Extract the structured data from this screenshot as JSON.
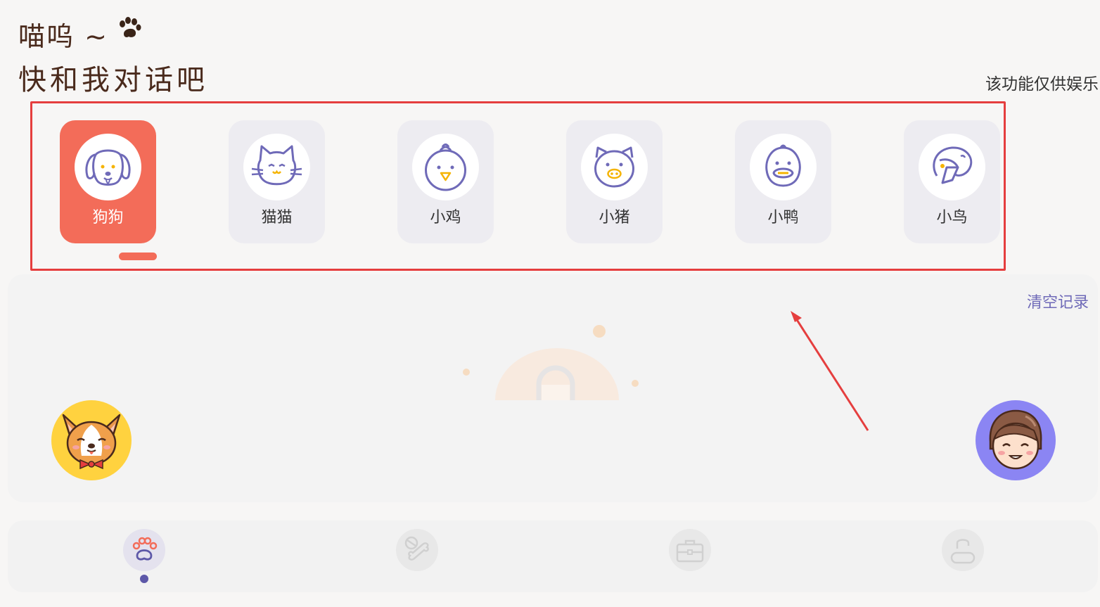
{
  "header": {
    "line1": "喵呜 ~",
    "line2": "快和我对话吧",
    "paw_icon": "paw-print-icon"
  },
  "disclaimer": "该功能仅供娱乐",
  "animals": [
    {
      "label": "狗狗",
      "icon": "dog-icon",
      "selected": true
    },
    {
      "label": "猫猫",
      "icon": "cat-icon",
      "selected": false
    },
    {
      "label": "小鸡",
      "icon": "chick-icon",
      "selected": false
    },
    {
      "label": "小猪",
      "icon": "pig-icon",
      "selected": false
    },
    {
      "label": "小鸭",
      "icon": "duck-icon",
      "selected": false
    },
    {
      "label": "小鸟",
      "icon": "bird-icon",
      "selected": false
    }
  ],
  "chat": {
    "clear_label": "清空记录"
  },
  "nav": [
    {
      "icon": "paw-icon",
      "active": true
    },
    {
      "icon": "bone-icon",
      "active": false
    },
    {
      "icon": "toolbox-icon",
      "active": false
    },
    {
      "icon": "user-icon",
      "active": false
    }
  ],
  "colors": {
    "accent": "#f36c59",
    "purple": "#6f6ab8",
    "highlight": "#e53e3e",
    "yellow": "#ffd23f"
  }
}
